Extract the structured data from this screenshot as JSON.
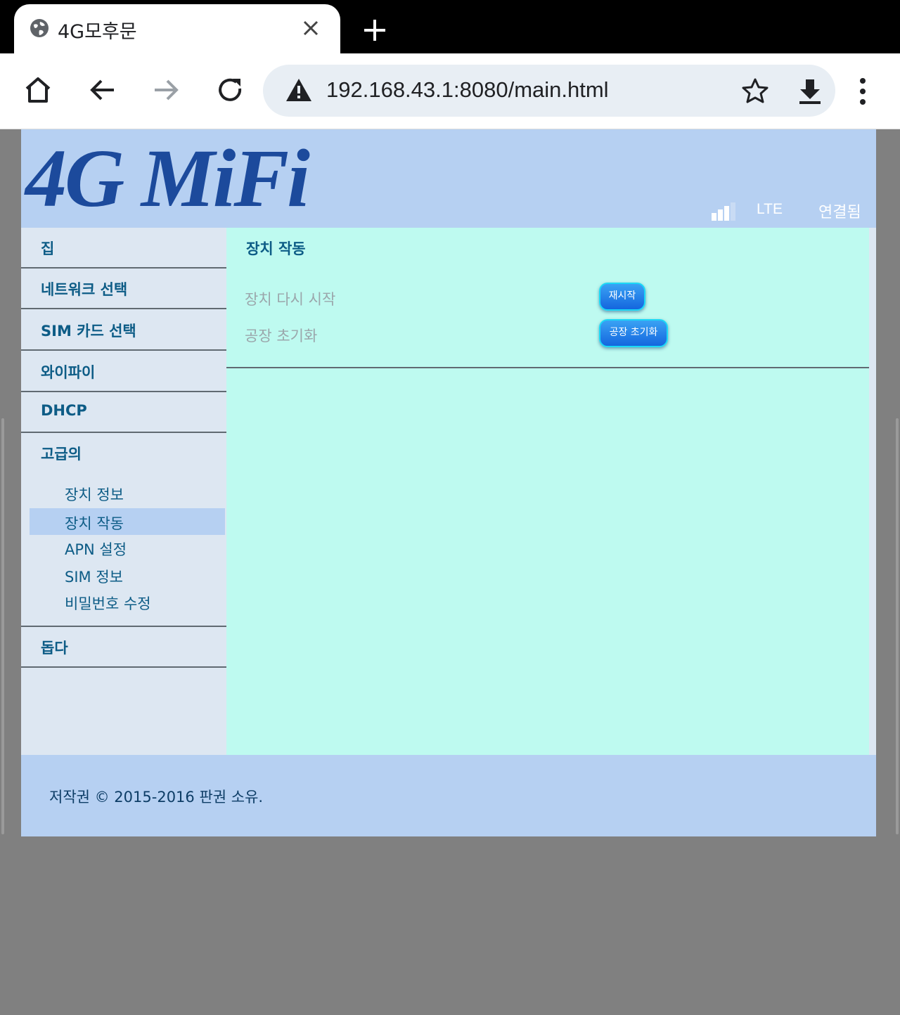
{
  "browser": {
    "tab_title": "4G모후문",
    "url": "192.168.43.1:8080/main.html"
  },
  "header": {
    "logo_text": "4G MiFi",
    "network_type": "LTE",
    "connection_status": "연결됨",
    "signal_bars": 3
  },
  "sidebar": {
    "items": [
      {
        "label": "집"
      },
      {
        "label": "네트워크 선택"
      },
      {
        "label": "SIM 카드 선택"
      },
      {
        "label": "와이파이"
      },
      {
        "label": "DHCP"
      },
      {
        "label": "고급의"
      },
      {
        "label": "돕다"
      }
    ],
    "sub_items": [
      {
        "label": "장치 정보"
      },
      {
        "label": "장치 작동"
      },
      {
        "label": "APN 설정"
      },
      {
        "label": "SIM 정보"
      },
      {
        "label": "비밀번호 수정"
      }
    ],
    "active_sub_item": "장치 작동"
  },
  "content": {
    "title": "장치 작동",
    "rows": [
      {
        "label": "장치 다시 시작",
        "button": "재시작"
      },
      {
        "label": "공장 초기화",
        "button": "공장 초기화"
      }
    ]
  },
  "footer": {
    "copyright": "저작권 © 2015-2016 판권 소유."
  },
  "colors": {
    "header_bg": "#b6d0f2",
    "content_bg": "#befaf0",
    "sidebar_bg": "#dde7f2",
    "nav_text": "#0d5c86",
    "logo": "#1c4a9c"
  }
}
